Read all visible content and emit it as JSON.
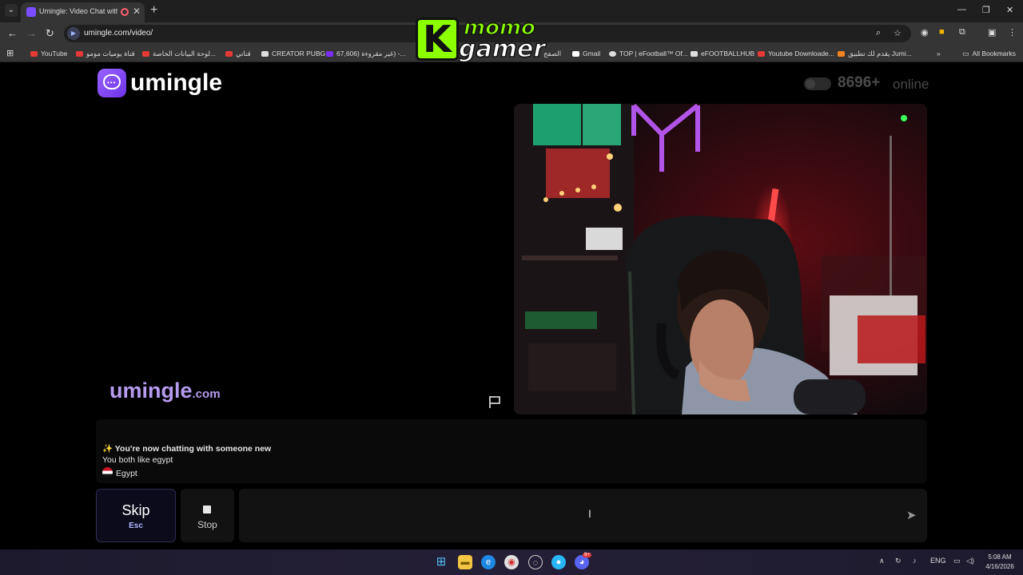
{
  "browser": {
    "tab_title": "Umingle: Video Chat with S",
    "url": "umingle.com/video/",
    "bookmarks": [
      "YouTube",
      "قناة يوميات مومو",
      "لوحة البيانات الخاصة...",
      "قناتي",
      "CREATOR PUBG",
      "67,606) غير مقروءة) -...",
      "الصفح",
      "Gmail",
      "TOP | eFootball™ Of...",
      "eFOOTBALLHUB",
      "Youtube Downloade...",
      "يقدم لك تطبيق Jumi..."
    ],
    "all_bookmarks": "All Bookmarks"
  },
  "overlay": {
    "line1": "momo",
    "line2": "gamer",
    "badge": "K"
  },
  "site": {
    "brand": "umingle",
    "online_count": "8696+",
    "online_label": "online",
    "watermark_main": "umingle",
    "watermark_suffix": ".com"
  },
  "chat": {
    "line1": "✨ You're now chatting with someone new",
    "line2": "You both like egypt",
    "country": "Egypt"
  },
  "controls": {
    "skip_label": "Skip",
    "skip_hint": "Esc",
    "stop_label": "Stop",
    "message_placeholder": ""
  },
  "taskbar": {
    "lang": "ENG",
    "time": "5:08 AM",
    "date": "4/16/2026",
    "discord_badge": "9+"
  },
  "colors": {
    "brand_purple": "#7c4dff",
    "watermark": "#b69cf0",
    "overlay_green": "#8cff00"
  }
}
